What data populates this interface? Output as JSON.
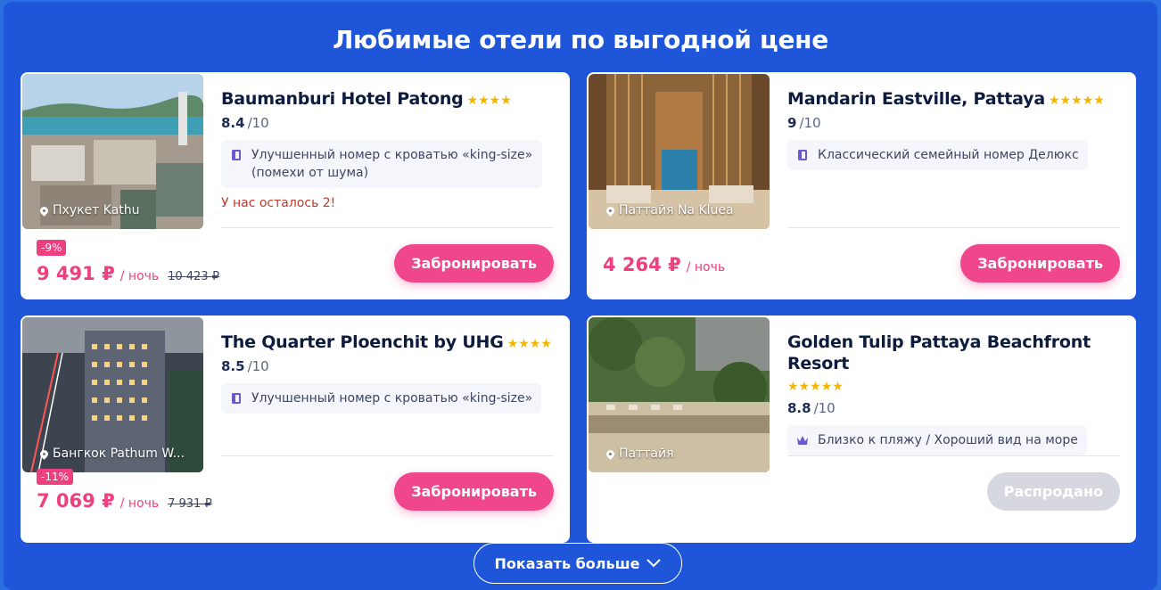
{
  "section_title": "Любимые отели по выгодной цене",
  "hotels": [
    {
      "name": "Baumanburi Hotel Patong",
      "stars": "★★★★",
      "rating": "8.4",
      "rating_max": "/10",
      "feature": "Улучшенный номер с кроватью «king-size» (помехи от шума)",
      "feature_icon": "door-icon",
      "warning": "У нас осталось 2!",
      "location": "Пхукет Kathu",
      "discount": "-9%",
      "price": "9 491 ₽",
      "per_night": "/ ночь",
      "old_price": "10 423 ₽",
      "button": "Забронировать"
    },
    {
      "name": "Mandarin Eastville, Pattaya",
      "stars": "★★★★★",
      "rating": "9",
      "rating_max": "/10",
      "feature": "Классический семейный номер Делюкс",
      "feature_icon": "door-icon",
      "location": "Паттайя Na Kluea",
      "price": "4 264 ₽",
      "per_night": "/ ночь",
      "button": "Забронировать"
    },
    {
      "name": "The Quarter Ploenchit by UHG",
      "stars": "★★★★",
      "rating": "8.5",
      "rating_max": "/10",
      "feature": "Улучшенный номер с кроватью «king-size»",
      "feature_icon": "door-icon",
      "location": "Бангкок Pathum W...",
      "discount": "-11%",
      "price": "7 069 ₽",
      "per_night": "/ ночь",
      "old_price": "7 931 ₽",
      "button": "Забронировать"
    },
    {
      "name": "Golden Tulip Pattaya Beachfront Resort",
      "stars": "★★★★★",
      "rating": "8.8",
      "rating_max": "/10",
      "feature": "Близко к пляжу / Хороший вид на море",
      "feature_icon": "crown-icon",
      "location": "Паттайя",
      "button": "Распродано"
    }
  ],
  "show_more": "Показать больше",
  "colors": {
    "accent": "#f0468c",
    "background": "#1f55d9",
    "star": "#f5b400"
  }
}
